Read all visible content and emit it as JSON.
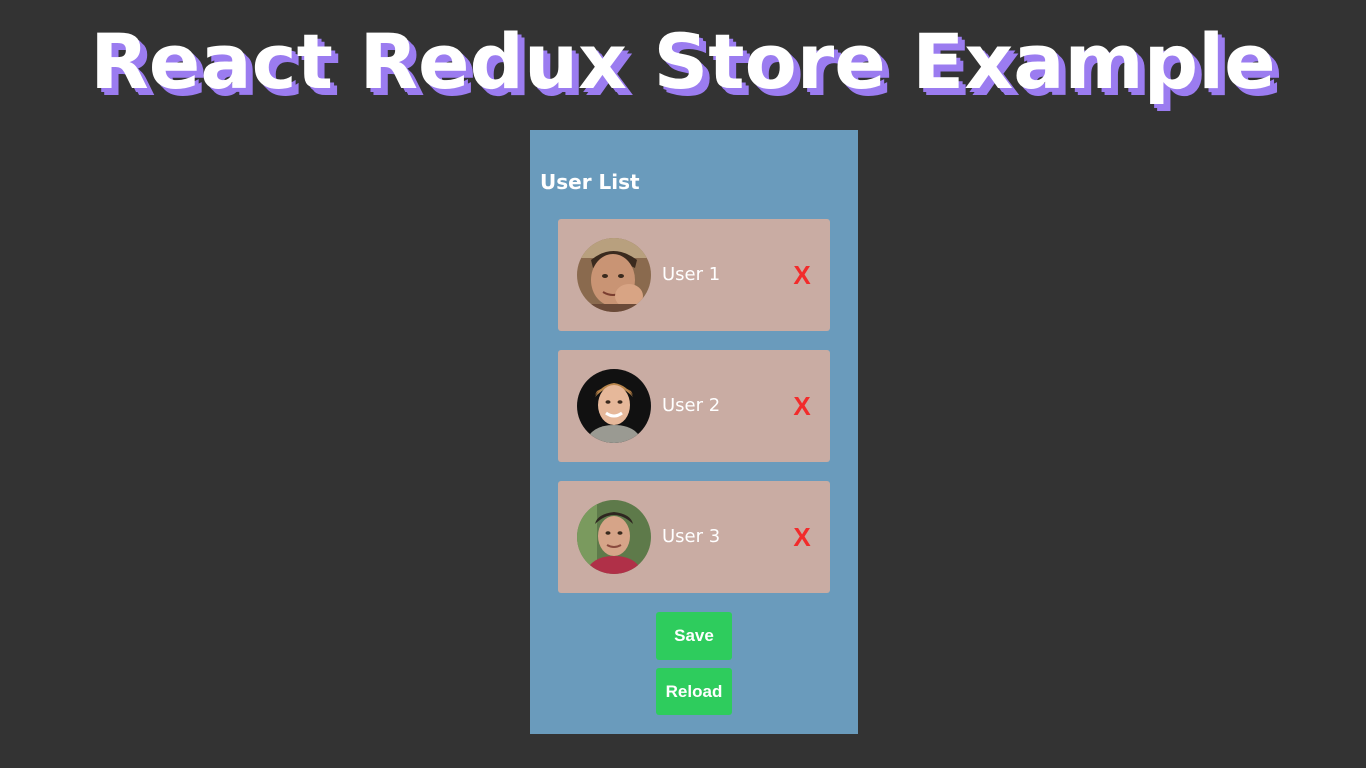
{
  "page": {
    "heading": "React Redux Store Example"
  },
  "panel": {
    "title": "User List",
    "users": [
      {
        "name": "User 1",
        "remove_label": "X"
      },
      {
        "name": "User 2",
        "remove_label": "X"
      },
      {
        "name": "User 3",
        "remove_label": "X"
      }
    ],
    "save_label": "Save",
    "reload_label": "Reload"
  },
  "colors": {
    "background": "#333333",
    "heading_shadow": "#9b7cf0",
    "panel": "#6a9bbc",
    "card": "#c9aca3",
    "remove": "#f22b2b",
    "button": "#2ecc5d"
  }
}
